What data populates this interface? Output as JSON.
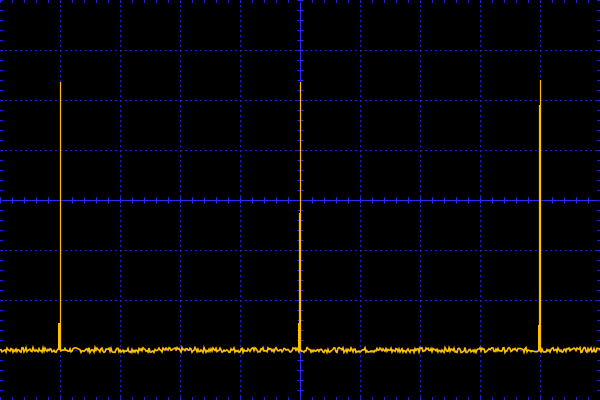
{
  "scope": {
    "colors": {
      "background": "#000000",
      "grid": "#1f1fd8",
      "grid_center": "#2a2aff",
      "trace": "#ffc000"
    },
    "grid": {
      "h_divisions": 10,
      "v_divisions": 8,
      "minor_ticks_per_division": 5
    }
  },
  "chart_data": {
    "type": "line",
    "x_unit": "divisions",
    "y_unit": "divisions",
    "xlim": [
      0,
      10
    ],
    "ylim": [
      -4,
      4
    ],
    "baseline": -3.0,
    "noise_amplitude": 0.05,
    "pulses": [
      {
        "x": 1.0,
        "peak": 2.36,
        "foot": -2.46
      },
      {
        "x": 5.0,
        "peak": 2.36,
        "secondary": -0.26,
        "foot": -2.46
      },
      {
        "x": 9.0,
        "peak": 2.4,
        "secondary": 1.9,
        "foot": -2.5
      }
    ]
  }
}
